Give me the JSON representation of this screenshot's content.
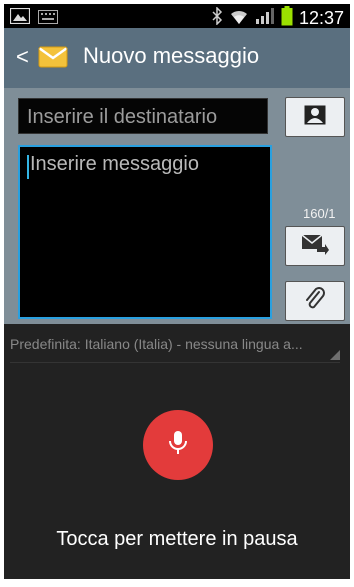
{
  "status_bar": {
    "time": "12:37",
    "icons": [
      "gallery-notification-icon",
      "keyboard-notification-icon",
      "bluetooth-icon",
      "wifi-icon",
      "signal-icon",
      "battery-icon"
    ],
    "battery_color": "#9be000"
  },
  "app_bar": {
    "title": "Nuovo messaggio",
    "back_label": "<",
    "app_icon": "envelope-icon",
    "background": "#5a6f7f"
  },
  "compose": {
    "recipient_placeholder": "Inserire il destinatario",
    "message_placeholder": "Inserire messaggio",
    "char_counter": "160/1",
    "contact_icon": "contact-icon",
    "send_icon": "send-icon",
    "attach_icon": "paperclip-icon",
    "accent": "#29a0e0"
  },
  "voice_input": {
    "language_label": "Predefinita: Italiano (Italia) - nessuna lingua a...",
    "mic_icon": "microphone-icon",
    "mic_color": "#e33b3b",
    "hint": "Tocca per mettere in pausa"
  }
}
